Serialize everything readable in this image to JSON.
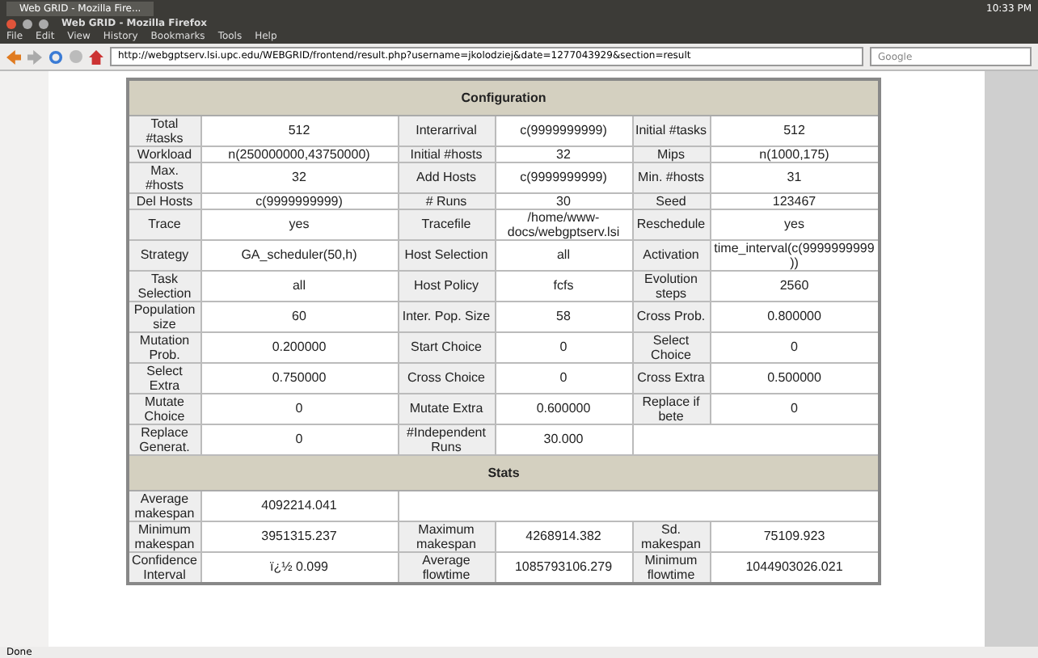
{
  "panel": {
    "task": "Web GRID - Mozilla Fire...",
    "clock": "10:33 PM"
  },
  "window": {
    "title": "Web GRID - Mozilla Firefox"
  },
  "menu": [
    "File",
    "Edit",
    "View",
    "History",
    "Bookmarks",
    "Tools",
    "Help"
  ],
  "url": "http://webgptserv.lsi.upc.edu/WEBGRID/frontend/result.php?username=jkolodziej&date=1277043929&section=result",
  "search": {
    "placeholder": "Google"
  },
  "sections": [
    {
      "title": "Configuration",
      "rows": [
        [
          "Total #tasks",
          "512",
          "Interarrival",
          "c(9999999999)",
          "Initial #tasks",
          "512"
        ],
        [
          "Workload",
          "n(250000000,43750000)",
          "Initial #hosts",
          "32",
          "Mips",
          "n(1000,175)"
        ],
        [
          "Max. #hosts",
          "32",
          "Add Hosts",
          "c(9999999999)",
          "Min. #hosts",
          "31"
        ],
        [
          "Del Hosts",
          "c(9999999999)",
          "# Runs",
          "30",
          "Seed",
          "123467"
        ],
        [
          "Trace",
          "yes",
          "Tracefile",
          "/home/www-docs/webgptserv.lsi",
          "Reschedule",
          "yes"
        ],
        [
          "Strategy",
          "GA_scheduler(50,h)",
          "Host Selection",
          "all",
          "Activation",
          "time_interval(c(9999999999))"
        ],
        [
          "Task Selection",
          "all",
          "Host Policy",
          "fcfs",
          "Evolution steps",
          "2560"
        ],
        [
          "Population size",
          "60",
          "Inter. Pop. Size",
          "58",
          "Cross Prob.",
          "0.800000"
        ],
        [
          "Mutation Prob.",
          "0.200000",
          "Start Choice",
          "0",
          "Select Choice",
          "0"
        ],
        [
          "Select Extra",
          "0.750000",
          "Cross Choice",
          "0",
          "Cross Extra",
          "0.500000"
        ],
        [
          "Mutate Choice",
          "0",
          "Mutate Extra",
          "0.600000",
          "Replace if bete",
          "0"
        ],
        [
          "Replace Generat.",
          "0",
          "#Independent Runs",
          "30.000"
        ]
      ]
    },
    {
      "title": "Stats",
      "rows": [
        [
          "Average makespan",
          "4092214.041"
        ],
        [
          "Minimum makespan",
          "3951315.237",
          "Maximum makespan",
          "4268914.382",
          "Sd. makespan",
          "75109.923"
        ],
        [
          "Confidence Interval",
          "ï¿½ 0.099",
          "Average flowtime",
          "1085793106.279",
          "Minimum flowtime",
          "1044903026.021"
        ]
      ]
    }
  ],
  "status": "Done"
}
